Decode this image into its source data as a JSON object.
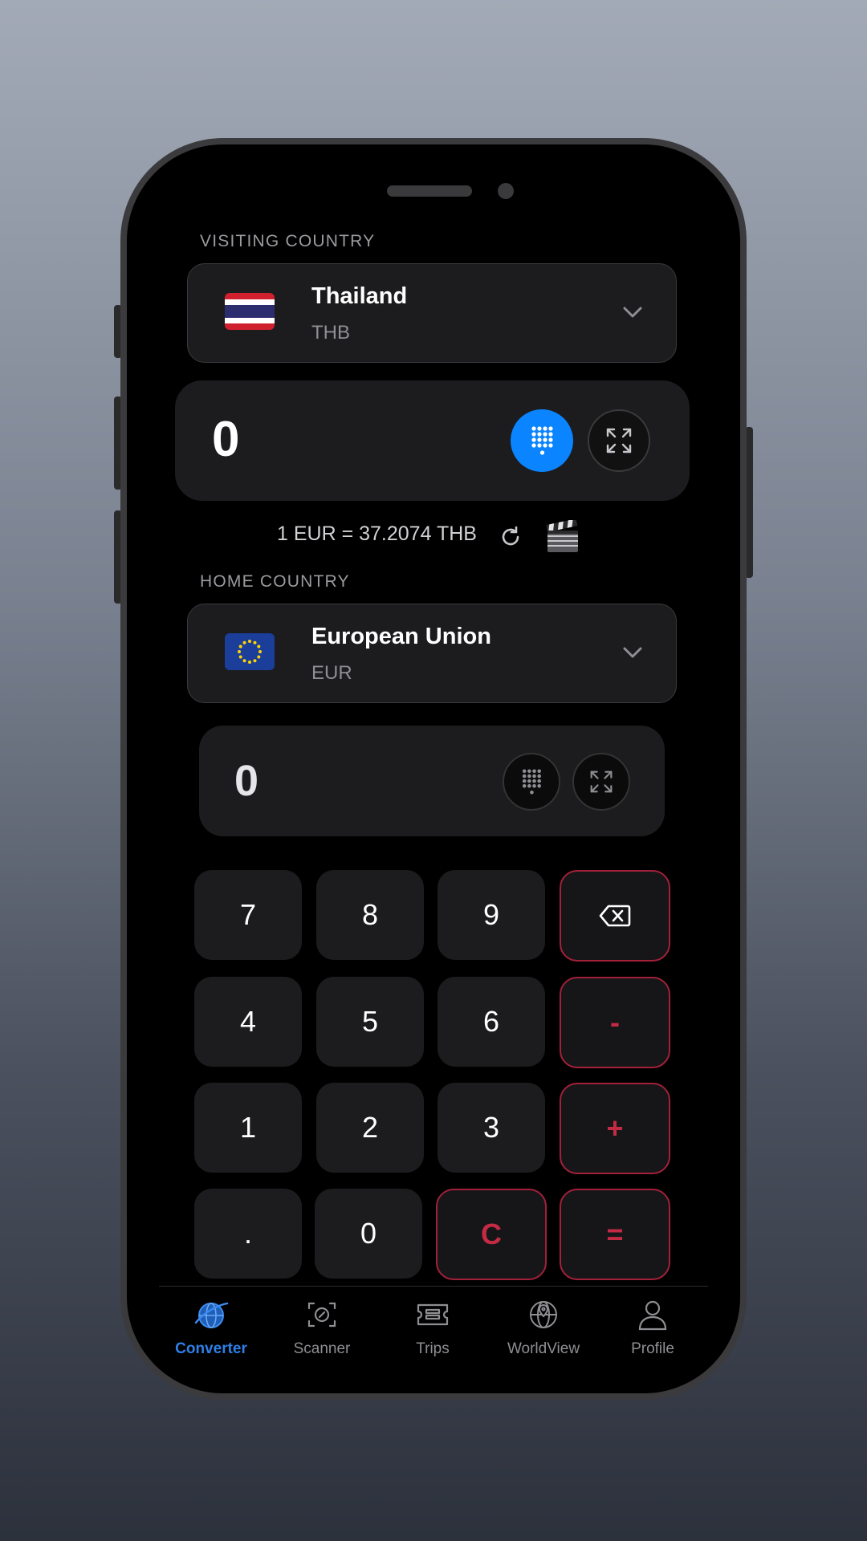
{
  "visiting": {
    "section_label": "VISITING COUNTRY",
    "country": "Thailand",
    "currency": "THB",
    "amount": "0"
  },
  "rate": {
    "text": "1 EUR = 37.2074 THB"
  },
  "home": {
    "section_label": "HOME COUNTRY",
    "country": "European Union",
    "currency": "EUR",
    "amount": "0"
  },
  "keypad": {
    "k7": "7",
    "k8": "8",
    "k9": "9",
    "k4": "4",
    "k5": "5",
    "k6": "6",
    "k1": "1",
    "k2": "2",
    "k3": "3",
    "kdot": ".",
    "k0": "0",
    "minus": "-",
    "plus": "+",
    "clear": "C",
    "equals": "="
  },
  "tabs": [
    {
      "label": "Converter",
      "icon": "globe-icon",
      "active": true
    },
    {
      "label": "Scanner",
      "icon": "scan-icon"
    },
    {
      "label": "Trips",
      "icon": "ticket-icon"
    },
    {
      "label": "WorldView",
      "icon": "map-pin-globe-icon"
    },
    {
      "label": "Profile",
      "icon": "person-icon"
    }
  ],
  "colors": {
    "accent_blue": "#0a84ff",
    "operator_red": "#a3203a",
    "key_bg": "#1c1c1e",
    "screen_bg": "#000000"
  }
}
